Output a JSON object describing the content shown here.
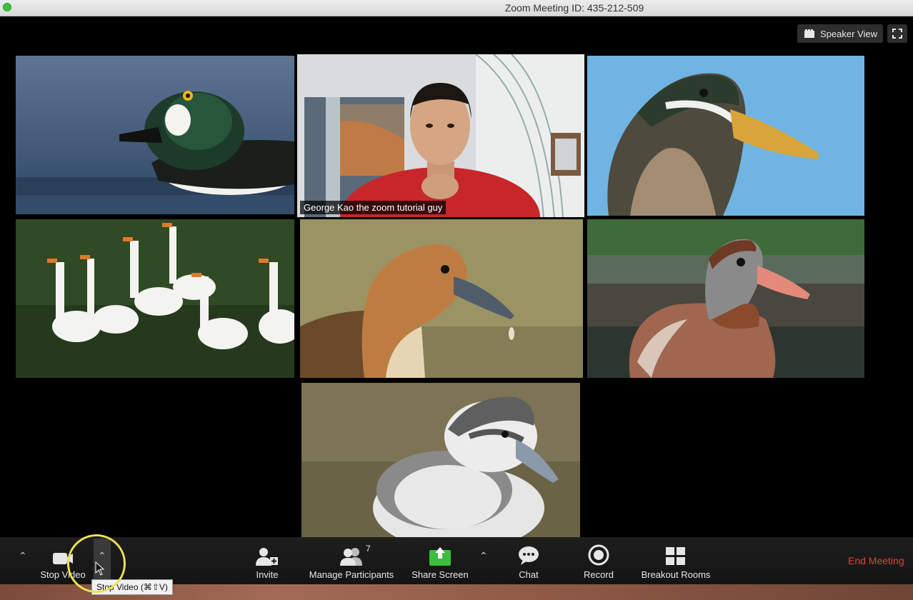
{
  "window": {
    "title": "Zoom Meeting ID: 435-212-509"
  },
  "top_controls": {
    "speaker_view_label": "Speaker View"
  },
  "participants": [
    {
      "id": "p1",
      "name": "",
      "subject": "goldeneye-duck"
    },
    {
      "id": "p2",
      "name": "George Kao the zoom tutorial guy",
      "subject": "person",
      "active_speaker": true
    },
    {
      "id": "p3",
      "name": "",
      "subject": "mallard-duck"
    },
    {
      "id": "p4",
      "name": "",
      "subject": "white-geese"
    },
    {
      "id": "p5",
      "name": "",
      "subject": "whistling-duck"
    },
    {
      "id": "p6",
      "name": "",
      "subject": "brown-duck"
    },
    {
      "id": "p7",
      "name": "",
      "subject": "duckling"
    }
  ],
  "toolbar": {
    "stop_video_label": "Stop Video",
    "invite_label": "Invite",
    "manage_participants_label": "Manage Participants",
    "participant_count": "7",
    "share_screen_label": "Share Screen",
    "chat_label": "Chat",
    "record_label": "Record",
    "breakout_rooms_label": "Breakout Rooms",
    "end_meeting_label": "End Meeting"
  },
  "tooltip": {
    "text": "Stop Video (⌘⇧V)"
  },
  "colors": {
    "active_speaker_border": "#e6f08a",
    "share_screen_green": "#3cbf3c",
    "end_meeting_red": "#e0443a",
    "highlight_ring": "#e8e25a"
  }
}
